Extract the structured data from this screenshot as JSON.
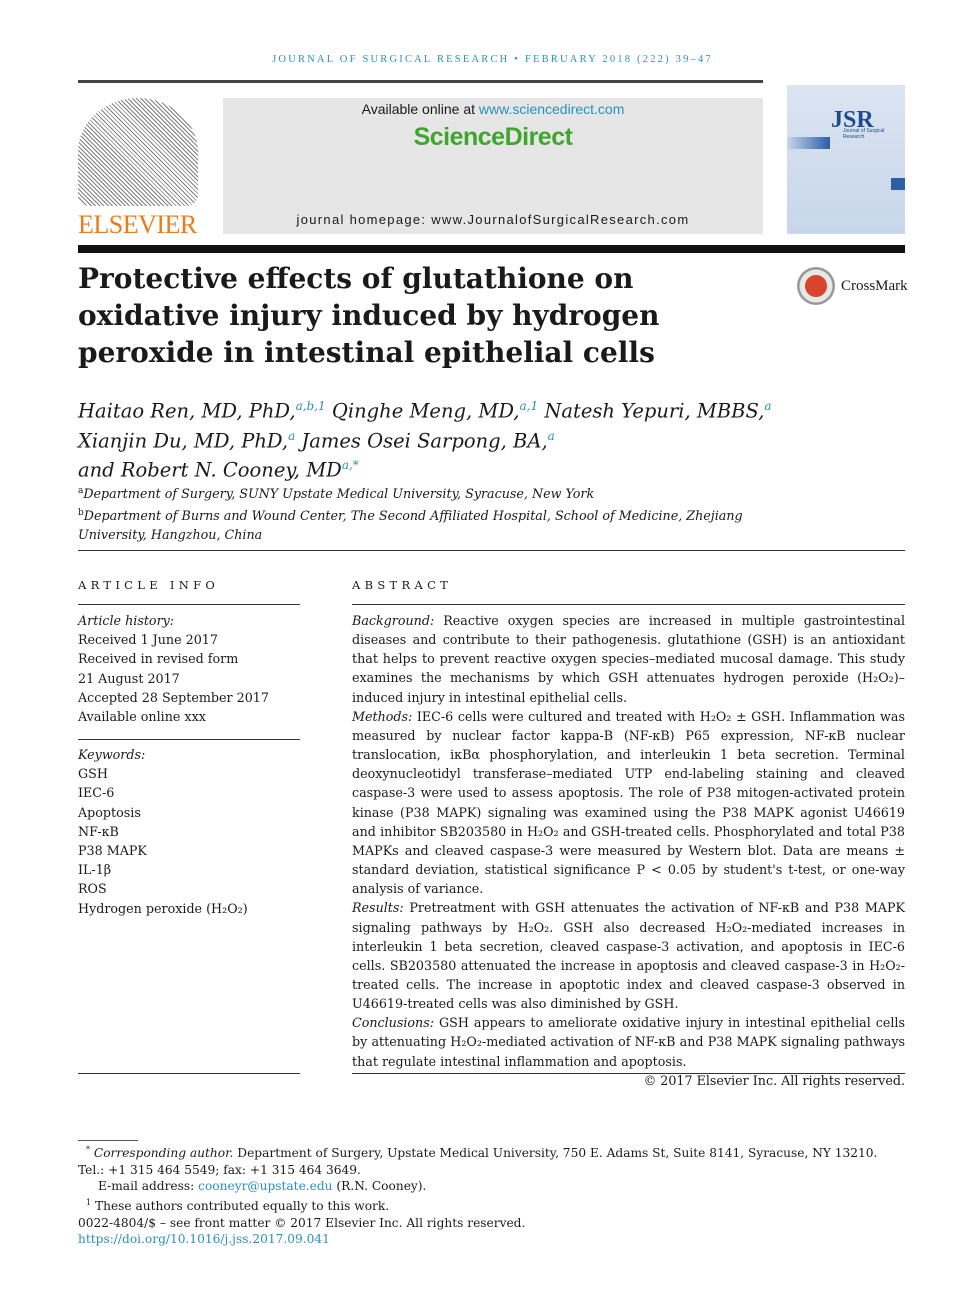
{
  "journal_header": "JOURNAL OF SURGICAL RESEARCH • FEBRUARY 2018 (222) 39–47",
  "publisher_logo": "ELSEVIER",
  "banner": {
    "available_prefix": "Available online at ",
    "available_link": "www.sciencedirect.com",
    "platform_logo": "ScienceDirect",
    "homepage": "journal homepage: www.JournalofSurgicalResearch.com"
  },
  "cover": {
    "logo": "JSR",
    "subtitle": "Journal of Surgical Research"
  },
  "crossmark": "CrossMark",
  "title": "Protective effects of glutathione on oxidative injury induced by hydrogen peroxide in intestinal epithelial cells",
  "authors": [
    {
      "name": "Haitao Ren, MD, PhD,",
      "sup": "a,b,1"
    },
    {
      "name": "Qinghe Meng, MD,",
      "sup": "a,1"
    },
    {
      "name": "Natesh Yepuri, MBBS,",
      "sup": "a"
    },
    {
      "name": "Xianjin Du, MD, PhD,",
      "sup": "a"
    },
    {
      "name": "James Osei Sarpong, BA,",
      "sup": "a"
    },
    {
      "name": "and Robert N. Cooney, MD",
      "sup": "a,*"
    }
  ],
  "affiliations": [
    {
      "sup": "a",
      "text": "Department of Surgery, SUNY Upstate Medical University, Syracuse, New York"
    },
    {
      "sup": "b",
      "text": "Department of Burns and Wound Center, The Second Affiliated Hospital, School of Medicine, Zhejiang University, Hangzhou, China"
    }
  ],
  "article_info": {
    "heading": "ARTICLE INFO",
    "history_label": "Article history:",
    "history": [
      "Received 1 June 2017",
      "Received in revised form",
      "21 August 2017",
      "Accepted 28 September 2017",
      "Available online xxx"
    ],
    "keywords_label": "Keywords:",
    "keywords": [
      "GSH",
      "IEC-6",
      "Apoptosis",
      "NF-κB",
      "P38 MAPK",
      "IL-1β",
      "ROS",
      "Hydrogen peroxide (H₂O₂)"
    ]
  },
  "abstract": {
    "heading": "ABSTRACT",
    "sections": [
      {
        "label": "Background:",
        "text": " Reactive oxygen species are increased in multiple gastrointestinal diseases and contribute to their pathogenesis. glutathione (GSH) is an antioxidant that helps to prevent reactive oxygen species–mediated mucosal damage. This study examines the mechanisms by which GSH attenuates hydrogen peroxide (H₂O₂)–induced injury in intestinal epithelial cells."
      },
      {
        "label": "Methods:",
        "text": " IEC-6 cells were cultured and treated with H₂O₂ ± GSH. Inflammation was measured by nuclear factor kappa-B (NF-κB) P65 expression, NF-κB nuclear translocation, iκBα phosphorylation, and interleukin 1 beta secretion. Terminal deoxynucleotidyl transferase–mediated UTP end-labeling staining and cleaved caspase-3 were used to assess apoptosis. The role of P38 mitogen-activated protein kinase (P38 MAPK) signaling was examined using the P38 MAPK agonist U46619 and inhibitor SB203580 in H₂O₂ and GSH-treated cells. Phosphorylated and total P38 MAPKs and cleaved caspase-3 were measured by Western blot. Data are means ± standard deviation, statistical significance P < 0.05 by student's t-test, or one-way analysis of variance."
      },
      {
        "label": "Results:",
        "text": " Pretreatment with GSH attenuates the activation of NF-κB and P38 MAPK signaling pathways by H₂O₂. GSH also decreased H₂O₂-mediated increases in interleukin 1 beta secretion, cleaved caspase-3 activation, and apoptosis in IEC-6 cells. SB203580 attenuated the increase in apoptosis and cleaved caspase-3 in H₂O₂-treated cells. The increase in apoptotic index and cleaved caspase-3 observed in U46619-treated cells was also diminished by GSH."
      },
      {
        "label": "Conclusions:",
        "text": " GSH appears to ameliorate oxidative injury in intestinal epithelial cells by attenuating H₂O₂-mediated activation of NF-κB and P38 MAPK signaling pathways that regulate intestinal inflammation and apoptosis."
      }
    ],
    "copyright": "© 2017 Elsevier Inc. All rights reserved."
  },
  "footnotes": {
    "corresponding_mark": "*",
    "corresponding_label": "Corresponding author.",
    "corresponding_text": " Department of Surgery, Upstate Medical University, 750 E. Adams St, Suite 8141, Syracuse, NY 13210. Tel.: +1 315 464 5549; fax: +1 315 464 3649.",
    "email_label": "E-mail address: ",
    "email": "cooneyr@upstate.edu",
    "email_suffix": " (R.N. Cooney).",
    "equal_mark": "1",
    "equal_text": " These authors contributed equally to this work.",
    "issn": "0022-4804/$ – see front matter © 2017 Elsevier Inc. All rights reserved.",
    "doi": "https://doi.org/10.1016/j.jss.2017.09.041"
  },
  "colors": {
    "link": "#2a8fc0",
    "sciencedirect": "#3fa62d",
    "elsevier": "#f07a1a"
  }
}
